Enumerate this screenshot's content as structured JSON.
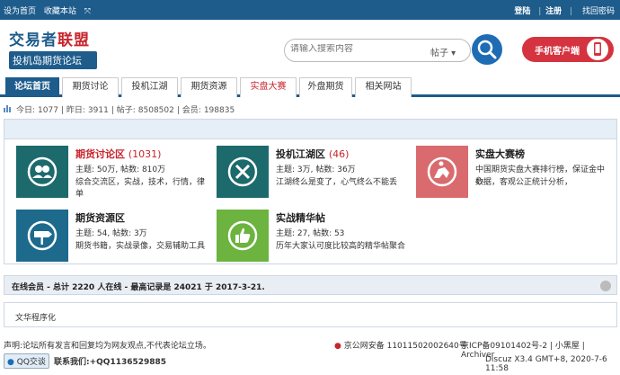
{
  "topbar": {
    "set_home": "设为首页",
    "bookmark": "收藏本站",
    "login": "登陆",
    "register": "注册",
    "retrieve": "找回密码"
  },
  "logo": {
    "line1a": "交易者",
    "line1b": "联盟",
    "line2": "投机岛期货论坛"
  },
  "search": {
    "placeholder": "请输入搜索内容",
    "type": "帖子"
  },
  "mobile_label": "手机客户端",
  "nav": {
    "tabs": [
      "论坛首页",
      "期货讨论",
      "投机江湖",
      "期货资源",
      "实盘大赛",
      "外盘期货",
      "相关网站"
    ]
  },
  "stats": {
    "today_label": "今日:",
    "today": "1077",
    "yesterday_label": "昨日:",
    "yesterday": "3911",
    "posts_label": "帖子:",
    "posts": "8508502",
    "members_label": "会员:",
    "members": "198835"
  },
  "forums": [
    {
      "name": "期货讨论区",
      "count": "(1031)",
      "line1": "主题: 50万, 帖数: 810万",
      "line2": "综合交流区，实战，技术，行情，律单",
      "color": "#1d6a6d"
    },
    {
      "name": "投机江湖区",
      "count": "(46)",
      "line1": "主题: 3万, 帖数: 36万",
      "line2": "江湖终么是变了，心气终么不能丢",
      "color": "#1d6a6d"
    },
    {
      "name": "实盘大赛榜",
      "count": "",
      "line1": "中国期货实盘大赛排行榜，保证金中心",
      "line2": "数据，客观公正统计分析，",
      "color": "#d96b6f"
    },
    {
      "name": "期货资源区",
      "count": "",
      "line1": "主题: 54, 帖数: 3万",
      "line2": "期货书籍，实战录像，交易辅助工具",
      "color": "#1d6a8c"
    },
    {
      "name": "实战精华帖",
      "count": "",
      "line1": "主题: 27, 帖数: 53",
      "line2": "历年大家认可度比较高的精华帖聚合",
      "color": "#6cb33f"
    }
  ],
  "online": "在线会员 - 总计 2220 人在线 - 最高记录是 24021 于 2017-3-21.",
  "culture": "文华程序化",
  "footer": {
    "declaration": "声明:论坛所有发言和回复均为网友观点,不代表论坛立场。",
    "police": "京公网安备 11011502002640号",
    "icp": "京ICP备09101402号-2 | 小黑屋 | Archiver",
    "qq": "QQ交谈",
    "contact": "联系我们:+QQ1136529885",
    "version": "Discuz X3.4 GMT+8, 2020-7-6 11:58"
  }
}
